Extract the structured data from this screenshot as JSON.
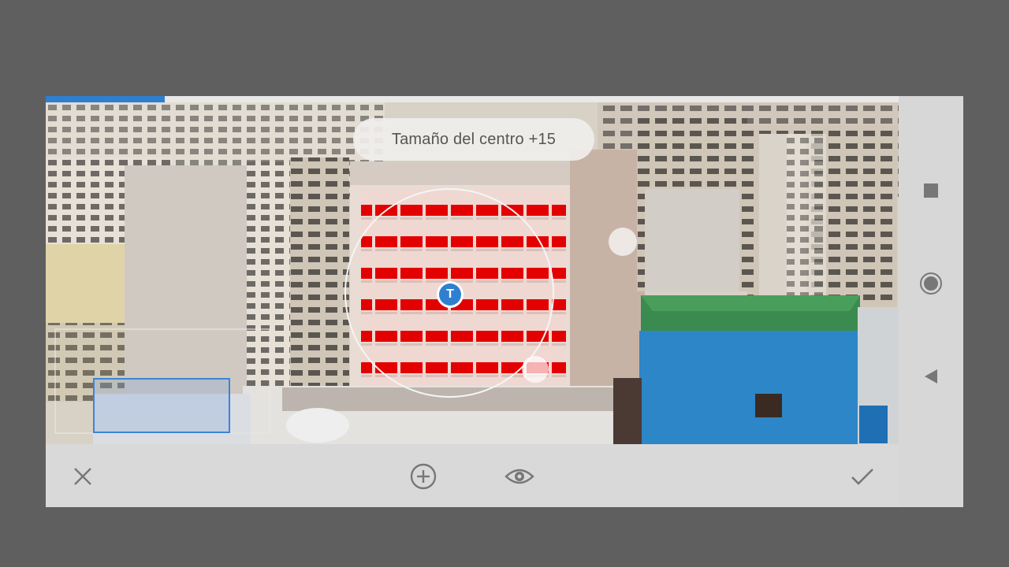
{
  "adjustment_tooltip": {
    "label": "Tamaño del centro",
    "value": "+15"
  },
  "control_point": {
    "letter": "T"
  },
  "edit_progress": {
    "fraction": 0.14
  },
  "toolbar": {
    "cancel_icon": "close-icon",
    "add_icon": "add-circle-icon",
    "preview_icon": "eye-icon",
    "apply_icon": "check-icon"
  },
  "android_nav": {
    "recents_icon": "square-icon",
    "home_icon": "circle-icon",
    "back_icon": "triangle-back-icon"
  },
  "colors": {
    "accent": "#2f7fd1",
    "mask_red": "#ff0000",
    "background": "#5f5f5f"
  }
}
